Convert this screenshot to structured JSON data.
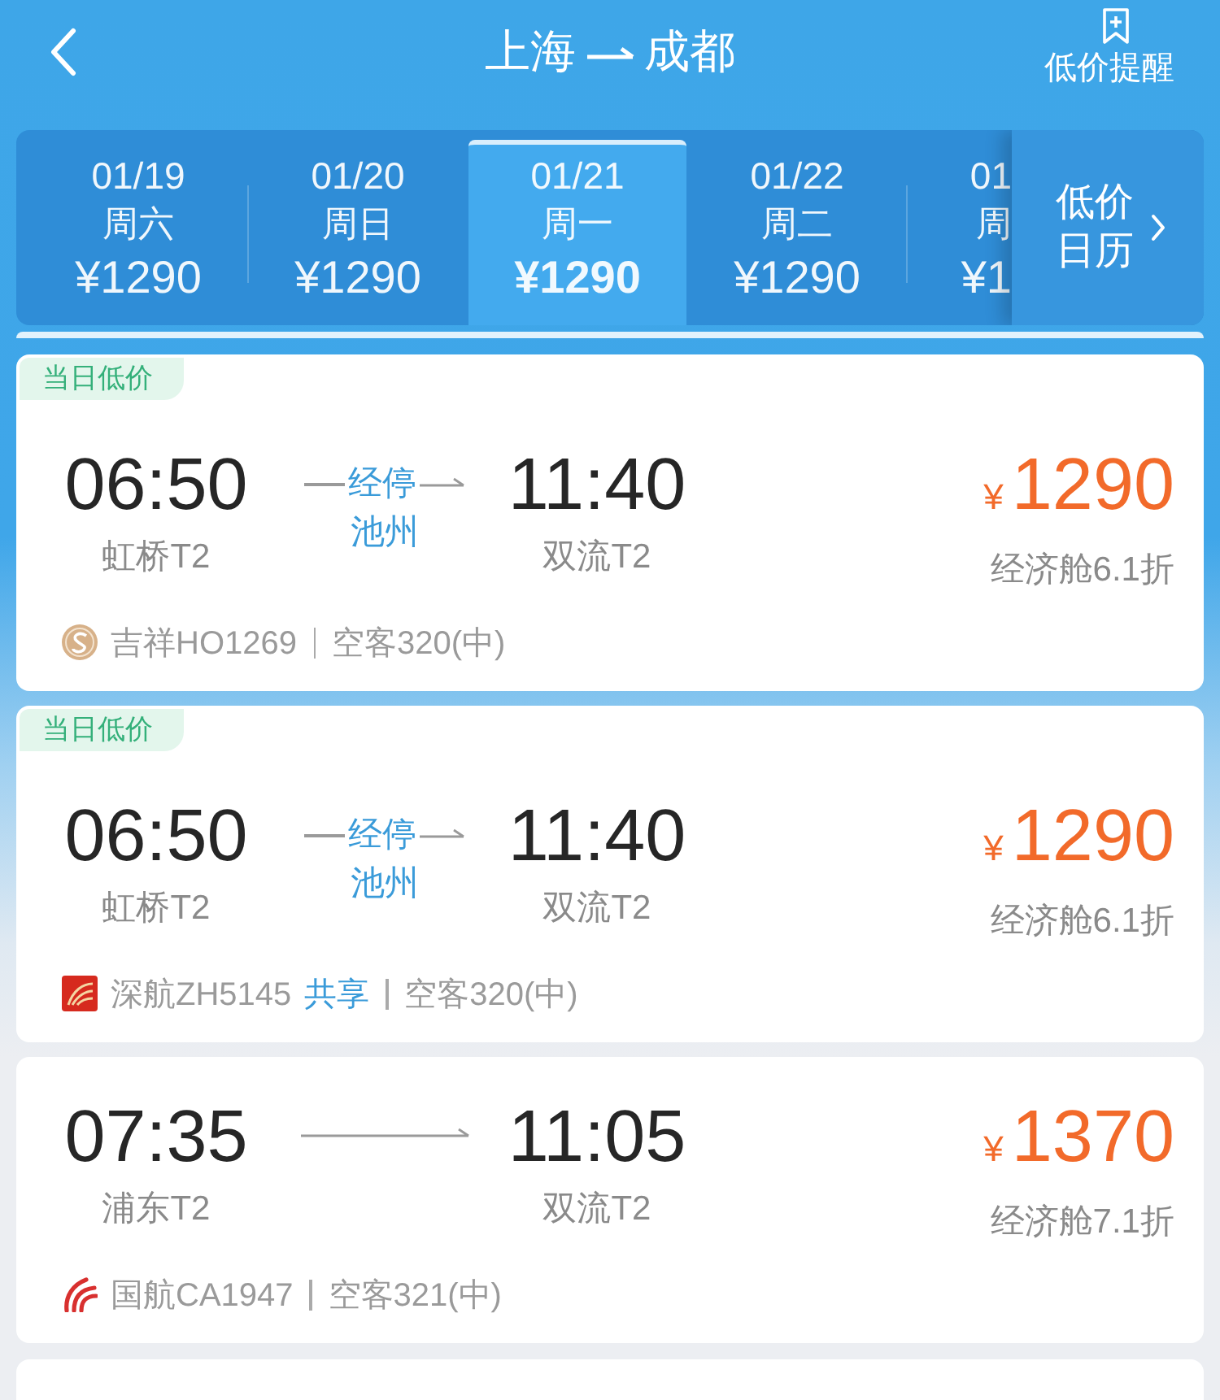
{
  "header": {
    "origin": "上海",
    "destination": "成都",
    "alert_label": "低价提醒"
  },
  "date_tabs": [
    {
      "date": "01/19",
      "weekday": "周六",
      "price": "¥1290",
      "selected": false
    },
    {
      "date": "01/20",
      "weekday": "周日",
      "price": "¥1290",
      "selected": false
    },
    {
      "date": "01/21",
      "weekday": "周一",
      "price": "¥1290",
      "selected": true
    },
    {
      "date": "01/22",
      "weekday": "周二",
      "price": "¥1290",
      "selected": false
    },
    {
      "date": "01",
      "weekday": "周",
      "price": "¥1",
      "selected": false
    }
  ],
  "calendar_button": {
    "label": "低价日历"
  },
  "flights": [
    {
      "kind": "disc-logo",
      "badge": "当日低价",
      "depart_time": "06:50",
      "depart_airport": "虹桥T2",
      "stop_label": "经停",
      "stop_city": "池州",
      "arrive_time": "11:40",
      "arrive_airport": "双流T2",
      "currency": "¥",
      "price": "1290",
      "cabin": "经济舱6.1折",
      "flight_no": "吉祥HO1269",
      "aircraft": "空客320(中)"
    },
    {
      "kind": "tile-logo",
      "badge": "当日低价",
      "depart_time": "06:50",
      "depart_airport": "虹桥T2",
      "stop_label": "经停",
      "stop_city": "池州",
      "arrive_time": "11:40",
      "arrive_airport": "双流T2",
      "currency": "¥",
      "price": "1290",
      "cabin": "经济舱6.1折",
      "flight_no": "深航ZH5145",
      "codeshare": "共享",
      "aircraft": "空客320(中)"
    },
    {
      "kind": "swirl-logo",
      "depart_time": "07:35",
      "depart_airport": "浦东T2",
      "arrive_time": "11:05",
      "arrive_airport": "双流T2",
      "currency": "¥",
      "price": "1370",
      "cabin": "经济舱7.1折",
      "flight_no": "国航CA1947",
      "aircraft": "空客321(中)"
    }
  ]
}
